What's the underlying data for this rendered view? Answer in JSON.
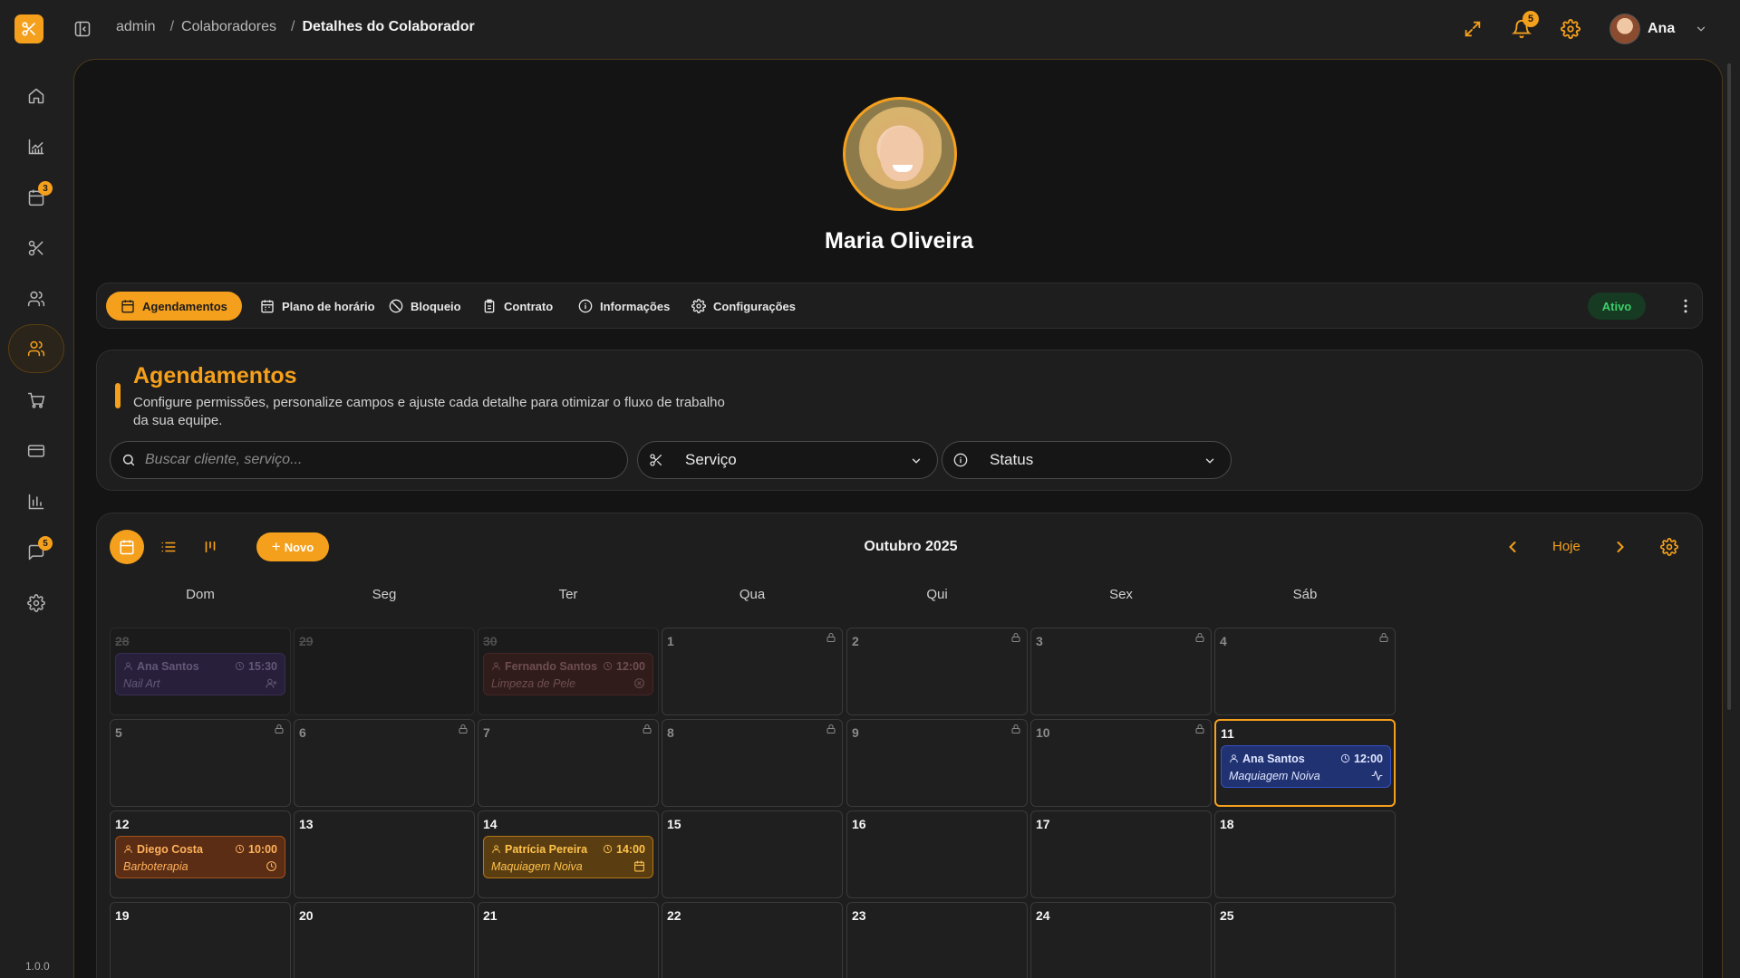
{
  "breadcrumb": {
    "items": [
      "admin",
      "Colaboradores"
    ],
    "separator": "/",
    "current": "Detalhes do Colaborador"
  },
  "topbar": {
    "notification_count": "5",
    "user_name": "Ana"
  },
  "sidebar": {
    "items": [
      {
        "name": "home",
        "icon": "home-icon"
      },
      {
        "name": "dashboard",
        "icon": "chart-line-icon"
      },
      {
        "name": "agenda",
        "icon": "calendar-icon",
        "badge": "3"
      },
      {
        "name": "servicos",
        "icon": "scissors-icon"
      },
      {
        "name": "clientes",
        "icon": "users-icon"
      },
      {
        "name": "colaboradores",
        "icon": "users-icon",
        "active": true
      },
      {
        "name": "vendas",
        "icon": "cart-icon"
      },
      {
        "name": "pagamentos",
        "icon": "credit-card-icon"
      },
      {
        "name": "relatorios",
        "icon": "bar-chart-icon"
      },
      {
        "name": "mensagens",
        "icon": "message-icon",
        "badge": "5"
      },
      {
        "name": "configuracoes",
        "icon": "gear-icon"
      }
    ],
    "version": "1.0.0"
  },
  "profile": {
    "name": "Maria Oliveira"
  },
  "tabs": [
    {
      "label": "Agendamentos",
      "icon": "calendar-icon",
      "active": true
    },
    {
      "label": "Plano de horário",
      "icon": "calendar-icon"
    },
    {
      "label": "Bloqueio",
      "icon": "ban-icon"
    },
    {
      "label": "Contrato",
      "icon": "clipboard-icon"
    },
    {
      "label": "Informações",
      "icon": "info-icon"
    },
    {
      "label": "Configurações",
      "icon": "gear-icon"
    }
  ],
  "status": {
    "label": "Ativo",
    "color": "#3ccf6a"
  },
  "section": {
    "title": "Agendamentos",
    "description": "Configure permissões, personalize campos e ajuste cada detalhe para otimizar o fluxo de trabalho da sua equipe."
  },
  "filters": {
    "search_placeholder": "Buscar cliente, serviço...",
    "service_label": "Serviço",
    "status_label": "Status"
  },
  "calendar": {
    "new_label": "Novo",
    "month_title": "Outubro 2025",
    "today_label": "Hoje",
    "weekdays": [
      "Dom",
      "Seg",
      "Ter",
      "Qua",
      "Qui",
      "Sex",
      "Sáb"
    ],
    "weeks": [
      [
        {
          "day": "28",
          "faded": true,
          "event": {
            "client": "Ana Santos",
            "time": "15:30",
            "service": "Nail Art",
            "color": "purple",
            "icon": "user-plus-icon"
          }
        },
        {
          "day": "29",
          "faded": true
        },
        {
          "day": "30",
          "faded": true,
          "event": {
            "client": "Fernando Santos",
            "time": "12:00",
            "service": "Limpeza de Pele",
            "color": "red",
            "icon": "x-circle-icon"
          }
        },
        {
          "day": "1",
          "locked": true
        },
        {
          "day": "2",
          "locked": true
        },
        {
          "day": "3",
          "locked": true
        },
        {
          "day": "4",
          "locked": true
        }
      ],
      [
        {
          "day": "5",
          "locked": true
        },
        {
          "day": "6",
          "locked": true
        },
        {
          "day": "7",
          "locked": true
        },
        {
          "day": "8",
          "locked": true
        },
        {
          "day": "9",
          "locked": true
        },
        {
          "day": "10",
          "locked": true
        },
        {
          "day": "11",
          "today": true,
          "event": {
            "client": "Ana Santos",
            "time": "12:00",
            "service": "Maquiagem Noiva",
            "color": "blue",
            "icon": "activity-icon"
          }
        }
      ],
      [
        {
          "day": "12",
          "event": {
            "client": "Diego Costa",
            "time": "10:00",
            "service": "Barboterapia",
            "color": "orange",
            "icon": "clock-icon"
          }
        },
        {
          "day": "13"
        },
        {
          "day": "14",
          "event": {
            "client": "Patrícia Pereira",
            "time": "14:00",
            "service": "Maquiagem Noiva",
            "color": "amber",
            "icon": "calendar-icon"
          }
        },
        {
          "day": "15"
        },
        {
          "day": "16"
        },
        {
          "day": "17"
        },
        {
          "day": "18"
        }
      ],
      [
        {
          "day": "19"
        },
        {
          "day": "20"
        },
        {
          "day": "21"
        },
        {
          "day": "22"
        },
        {
          "day": "23"
        },
        {
          "day": "24"
        },
        {
          "day": "25"
        }
      ]
    ]
  },
  "colors": {
    "accent": "#f5a01c",
    "background": "#1f1f1f",
    "panel": "#141414"
  }
}
